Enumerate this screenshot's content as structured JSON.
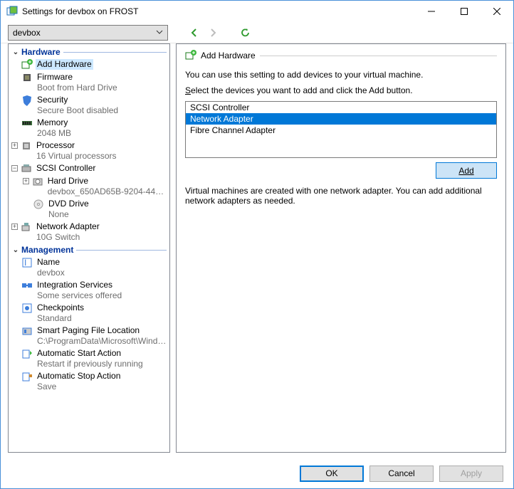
{
  "window": {
    "title": "Settings for devbox on FROST"
  },
  "toolbar": {
    "vm_selected": "devbox"
  },
  "tree": {
    "hardware_label": "Hardware",
    "management_label": "Management",
    "items": {
      "add_hardware": {
        "label": "Add Hardware"
      },
      "firmware": {
        "label": "Firmware",
        "sub": "Boot from Hard Drive"
      },
      "security": {
        "label": "Security",
        "sub": "Secure Boot disabled"
      },
      "memory": {
        "label": "Memory",
        "sub": "2048 MB"
      },
      "processor": {
        "label": "Processor",
        "sub": "16 Virtual processors"
      },
      "scsi": {
        "label": "SCSI Controller"
      },
      "hard_drive": {
        "label": "Hard Drive",
        "sub": "devbox_650AD65B-9204-4449..."
      },
      "dvd": {
        "label": "DVD Drive",
        "sub": "None"
      },
      "netadapter": {
        "label": "Network Adapter",
        "sub": "10G Switch"
      },
      "name": {
        "label": "Name",
        "sub": "devbox"
      },
      "integration": {
        "label": "Integration Services",
        "sub": "Some services offered"
      },
      "checkpoints": {
        "label": "Checkpoints",
        "sub": "Standard"
      },
      "paging": {
        "label": "Smart Paging File Location",
        "sub": "C:\\ProgramData\\Microsoft\\Windo..."
      },
      "autostart": {
        "label": "Automatic Start Action",
        "sub": "Restart if previously running"
      },
      "autostop": {
        "label": "Automatic Stop Action",
        "sub": "Save"
      }
    }
  },
  "content": {
    "title": "Add Hardware",
    "desc1": "You can use this setting to add devices to your virtual machine.",
    "desc2": "Select the devices you want to add and click the Add button.",
    "list": {
      "item0": "SCSI Controller",
      "item1": "Network Adapter",
      "item2": "Fibre Channel Adapter"
    },
    "add_label": "Add",
    "hint": "Virtual machines are created with one network adapter. You can add additional network adapters as needed."
  },
  "footer": {
    "ok": "OK",
    "cancel": "Cancel",
    "apply": "Apply"
  }
}
